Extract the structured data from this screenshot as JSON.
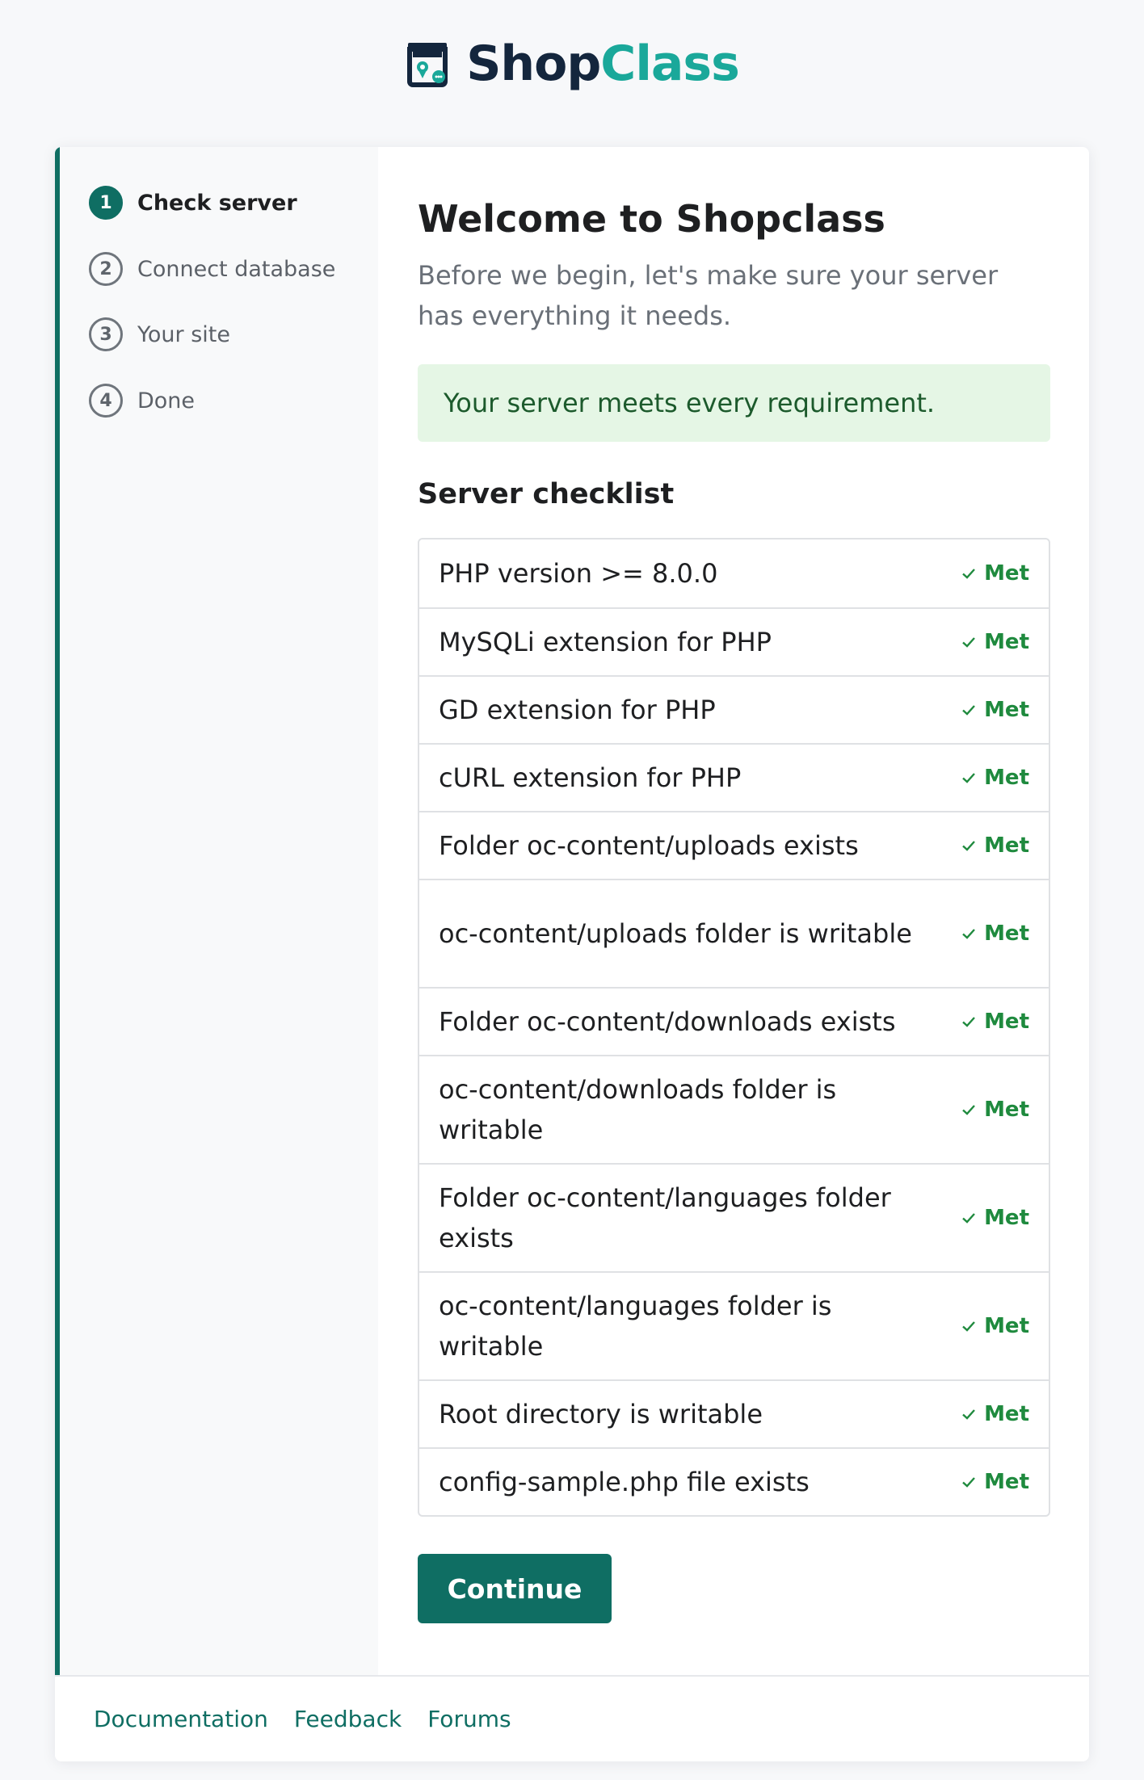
{
  "brand": {
    "name_part1": "Shop",
    "name_part2": "Class",
    "colors": {
      "dark": "#14263d",
      "accent": "#1aa89a"
    },
    "icon": "shop-logo-icon"
  },
  "steps": [
    {
      "number": "1",
      "label": "Check server",
      "active": true
    },
    {
      "number": "2",
      "label": "Connect database",
      "active": false
    },
    {
      "number": "3",
      "label": "Your site",
      "active": false
    },
    {
      "number": "4",
      "label": "Done",
      "active": false
    }
  ],
  "main": {
    "title": "Welcome to Shopclass",
    "subtitle": "Before we begin, let's make sure your server has everything it needs.",
    "alert": "Your server meets every requirement.",
    "checklist_title": "Server checklist",
    "status_label": "Met",
    "status_icon": "check-icon",
    "items": [
      "PHP version >= 8.0.0",
      "MySQLi extension for PHP",
      "GD extension for PHP",
      "cURL extension for PHP",
      "Folder oc-content/uploads exists",
      "oc-content/uploads folder is writable",
      "Folder oc-content/downloads exists",
      "oc-content/downloads folder is writable",
      "Folder oc-content/languages folder exists",
      "oc-content/languages folder is writable",
      "Root directory is writable",
      "config-sample.php file exists"
    ],
    "continue_label": "Continue"
  },
  "footer": {
    "links": [
      "Documentation",
      "Feedback",
      "Forums"
    ]
  },
  "colors": {
    "primary": "#0f6e63",
    "success_text": "#1f8a3e",
    "alert_bg": "#e5f6e5"
  }
}
